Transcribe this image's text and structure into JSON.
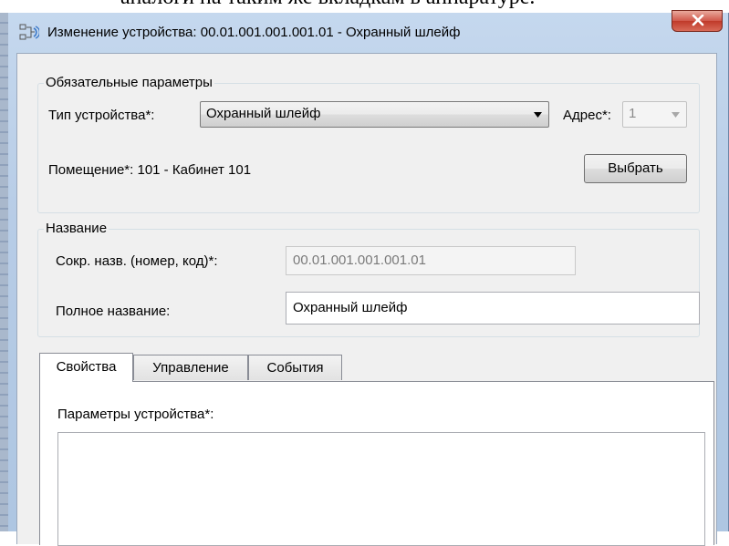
{
  "document_fragment": "аналоги на таким же вкладкам в аппаратуре.",
  "window": {
    "title": "Изменение устройства: 00.01.001.001.001.01 - Охранный шлейф",
    "icon": "device-edit-icon",
    "close_icon": "close-icon"
  },
  "required_params": {
    "legend": "Обязательные параметры",
    "device_type_label": "Тип устройства*:",
    "device_type_value": "Охранный шлейф",
    "address_label": "Адрес*:",
    "address_value": "1",
    "room_label": "Помещение*: 101 - Кабинет 101",
    "select_button": "Выбрать"
  },
  "name_group": {
    "legend": "Название",
    "short_name_label": "Сокр. назв. (номер, код)*:",
    "short_name_value": "00.01.001.001.001.01",
    "full_name_label": "Полное название:",
    "full_name_value": "Охранный шлейф"
  },
  "tabs": [
    {
      "label": "Свойства",
      "active": true
    },
    {
      "label": "Управление",
      "active": false
    },
    {
      "label": "События",
      "active": false
    }
  ],
  "properties_tab": {
    "device_params_label": "Параметры устройства*:"
  },
  "colors": {
    "title_bar": "#b7cce6",
    "close_button": "#c8453a",
    "client_bg": "#f0f0f0"
  }
}
